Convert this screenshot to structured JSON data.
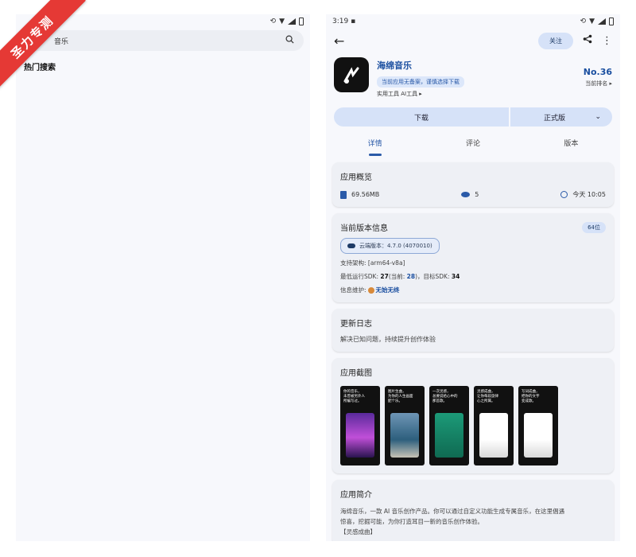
{
  "left": {
    "search": {
      "text": "音乐"
    },
    "hot_search_title": "热门搜索"
  },
  "right": {
    "status_time": "3:19",
    "follow_label": "关注",
    "app": {
      "name": "海绵音乐",
      "tag": "当前应用无备案，谨慎选择下载",
      "category": "实用工具 AI工具 ▸",
      "rank": "No.36",
      "rank_label": "当前排名 ▸"
    },
    "download_label": "下载",
    "version_channel": "正式版",
    "tabs": [
      "详情",
      "评论",
      "版本"
    ],
    "overview": {
      "title": "应用概览",
      "size": "69.56MB",
      "views": "5",
      "updated": "今天 10:05"
    },
    "version_info": {
      "title": "当前版本信息",
      "bits": "64位",
      "cloud_version": "云端版本：4.7.0 (4070010)",
      "arch": "支持架构: [arm64-v8a]",
      "sdk_prefix": "最低运行SDK: ",
      "sdk_min": "27",
      "sdk_current_prefix": "(当前: ",
      "sdk_current": "28",
      "sdk_target_prefix": ")，目标SDK: ",
      "sdk_target": "34",
      "maintainer_prefix": "信息维护:",
      "maintainer": "无始无终"
    },
    "changelog": {
      "title": "更新日志",
      "text": "解决已知问题，持续提升创作体验"
    },
    "screenshots": {
      "title": "应用截图",
      "items": [
        {
          "caption": "你的音乐，\n未曾被另外人\n所编写过。",
          "color": "#8a3fd1"
        },
        {
          "caption": "图片生曲，\n为你的人生画面\n配个乐。",
          "color": "#3e6a8f"
        },
        {
          "caption": "一次灵感，\n总要说给心中的\n那首歌。",
          "color": "#1c9a78"
        },
        {
          "caption": "灵感成曲，\n让你每段旋律\n心之所属。",
          "color": "#f4f4f4"
        },
        {
          "caption": "写词成曲，\n把你的文字\n变成歌。",
          "color": "#f4f4f4"
        }
      ]
    },
    "intro": {
      "title": "应用简介",
      "line1": "海绵音乐，一款 AI 音乐创作产品。你可以通过自定义功能生成专属音乐，在这里倡遇",
      "line2": "惊喜，挖掘可能，为你打造耳目一新的音乐创作体验。",
      "line3": "【灵感成曲】"
    }
  },
  "watermark": "圣力专测"
}
